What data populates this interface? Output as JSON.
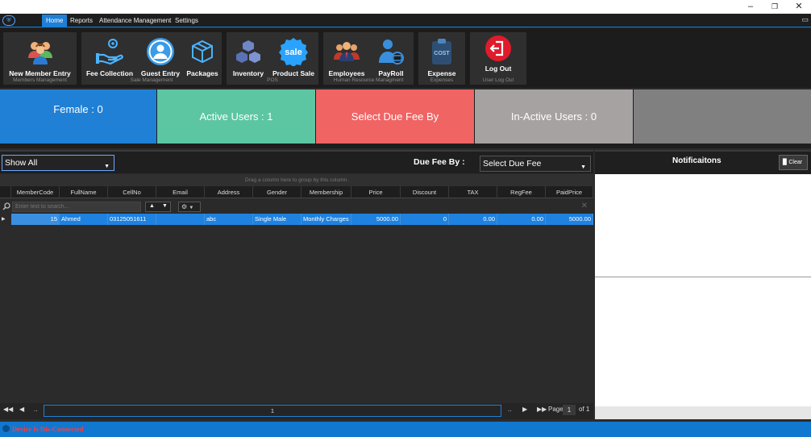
{
  "window": {
    "minimize": "–",
    "maximize": "❐",
    "close": "✕"
  },
  "menu": {
    "tabs": [
      "Home",
      "Reports",
      "Attendance Management",
      "Settings"
    ],
    "collapse_icon": "▭"
  },
  "ribbon": {
    "groups": [
      {
        "caption": "Members Management",
        "buttons": [
          "New Member Entry"
        ]
      },
      {
        "caption": "Sale Management",
        "buttons": [
          "Fee Collection",
          "Guest Entry",
          "Packages"
        ]
      },
      {
        "caption": "POS",
        "buttons": [
          "Inventory",
          "Product Sale"
        ]
      },
      {
        "caption": "Human Resource Managment",
        "buttons": [
          "Employees",
          "PayRoll"
        ]
      },
      {
        "caption": "Expenses",
        "buttons": [
          "Expense"
        ]
      },
      {
        "caption": "User Log Out",
        "buttons": [
          "Log Out"
        ]
      }
    ],
    "sale_badge": "sale",
    "cost_badge": "COST"
  },
  "tiles": [
    {
      "text": "Female : 0",
      "color": "#1f80d6"
    },
    {
      "text": "Active Users : 1",
      "color": "#5cc6a3"
    },
    {
      "text": "Select Due Fee By",
      "color": "#f06464"
    },
    {
      "text": "In-Active Users : 0",
      "color": "#a7a2a2"
    }
  ],
  "toolbar": {
    "show_select": "Show All",
    "due_label": "Due Fee By :",
    "due_select": "Select Due Fee"
  },
  "grid": {
    "group_hint": "Drag a column here to group by this column.",
    "columns": [
      "MemberCode",
      "FullName",
      "CellNo",
      "Email",
      "Address",
      "Gender",
      "Membership",
      "Price",
      "Discount",
      "TAX",
      "RegFee",
      "PaidPrice"
    ],
    "filter_placeholder": "Enter text to search...",
    "rows": [
      [
        "15",
        "Ahmed",
        "03125051611",
        "",
        "abc",
        "Single Male",
        "Monthly Charges",
        "5000.00",
        "0",
        "0.00",
        "0.00",
        "5000.00"
      ]
    ]
  },
  "pager": {
    "first": "◀◀",
    "prev": "◀",
    "ellipsis_left": "..",
    "page_input": "1",
    "ellipsis_right": "..",
    "next": "▶",
    "last": "▶▶",
    "page_label": "Page",
    "page_value": "1",
    "of_label": "of 1"
  },
  "notifications": {
    "title": "Notificaitons",
    "clear_label": "Clear"
  },
  "status": {
    "text": "Device Is Dis-Connected"
  }
}
